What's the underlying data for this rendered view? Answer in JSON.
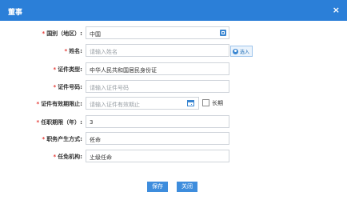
{
  "dialog": {
    "title": "董事",
    "close": "×"
  },
  "form": {
    "country": {
      "label": "国别（地区）:",
      "value": "中国"
    },
    "name": {
      "label": "姓名:",
      "placeholder": "请输入姓名",
      "import_label": "选入"
    },
    "id_type": {
      "label": "证件类型:",
      "value": "中华人民共和国居民身份证"
    },
    "id_number": {
      "label": "证件号码:",
      "placeholder": "请输入证件号码"
    },
    "id_expiry": {
      "label": "证件有效期限止:",
      "placeholder": "请输入证件有效期止",
      "longterm_label": "长期"
    },
    "term": {
      "label": "任职期限（年）:",
      "value": "3"
    },
    "method": {
      "label": "职务产生方式:",
      "value": "任命"
    },
    "authority": {
      "label": "任免机构:",
      "value": "上级任命"
    }
  },
  "buttons": {
    "save": "保存",
    "close": "关闭"
  }
}
